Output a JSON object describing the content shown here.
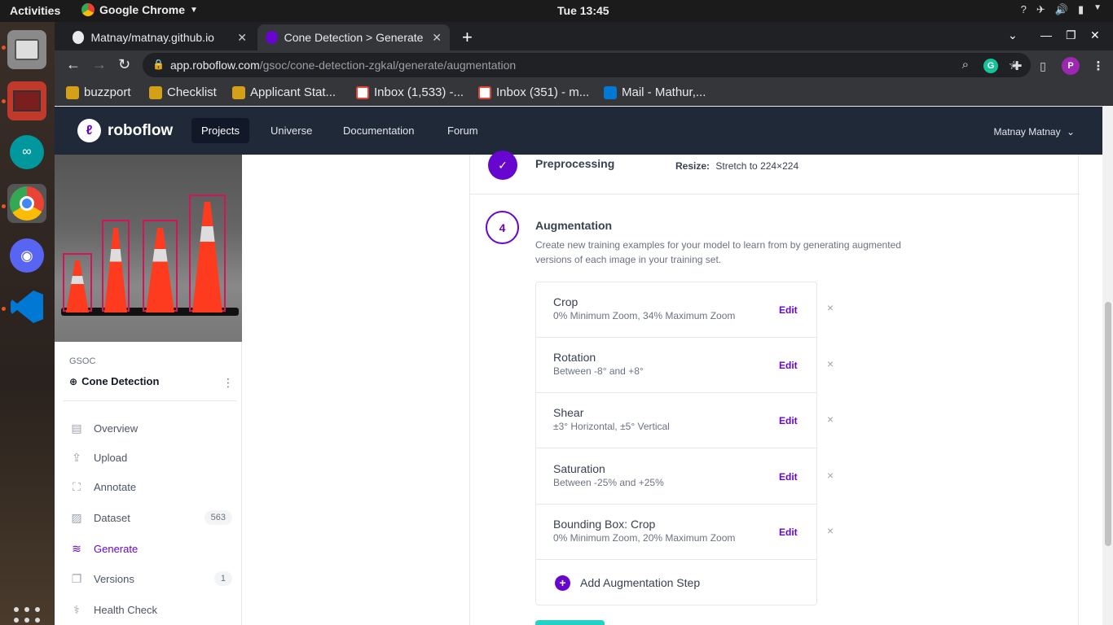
{
  "system": {
    "activities": "Activities",
    "app_name": "Google Chrome",
    "clock": "Tue 13:45"
  },
  "browser": {
    "tabs": [
      {
        "title": "Matnay/matnay.github.io"
      },
      {
        "title": "Cone Detection > Generate"
      }
    ],
    "url_host": "app.roboflow.com",
    "url_path": "/gsoc/cone-detection-zgkal/generate/augmentation",
    "bookmarks": [
      {
        "label": "buzzport"
      },
      {
        "label": "Checklist"
      },
      {
        "label": "Applicant Stat..."
      },
      {
        "label": "Inbox (1,533) -..."
      },
      {
        "label": "Inbox (351) - m..."
      },
      {
        "label": "Mail - Mathur,..."
      }
    ],
    "profile_initial": "P"
  },
  "nav": {
    "brand": "roboflow",
    "links": [
      "Projects",
      "Universe",
      "Documentation",
      "Forum"
    ],
    "user": "Matnay Matnay"
  },
  "sidebar": {
    "workspace": "GSOC",
    "project": "Cone Detection",
    "items": [
      {
        "label": "Overview"
      },
      {
        "label": "Upload"
      },
      {
        "label": "Annotate"
      },
      {
        "label": "Dataset",
        "badge": "563"
      },
      {
        "label": "Generate"
      },
      {
        "label": "Versions",
        "badge": "1"
      },
      {
        "label": "Health Check"
      }
    ]
  },
  "preprocessing": {
    "title": "Preprocessing",
    "resize_label": "Resize:",
    "resize_value": "Stretch to 224×224"
  },
  "augmentation": {
    "step": "4",
    "title": "Augmentation",
    "description": "Create new training examples for your model to learn from by generating augmented versions of each image in your training set.",
    "edit_label": "Edit",
    "remove_label": "×",
    "steps": [
      {
        "name": "Crop",
        "detail": "0% Minimum Zoom, 34% Maximum Zoom"
      },
      {
        "name": "Rotation",
        "detail": "Between -8° and +8°"
      },
      {
        "name": "Shear",
        "detail": "±3° Horizontal, ±5° Vertical"
      },
      {
        "name": "Saturation",
        "detail": "Between -25% and +25%"
      },
      {
        "name": "Bounding Box: Crop",
        "detail": "0% Minimum Zoom, 20% Maximum Zoom"
      }
    ],
    "add_step": "Add Augmentation Step"
  },
  "colors": {
    "accent": "#6706ce",
    "nav_bg": "#1f2937",
    "continue": "#22d3c5"
  }
}
